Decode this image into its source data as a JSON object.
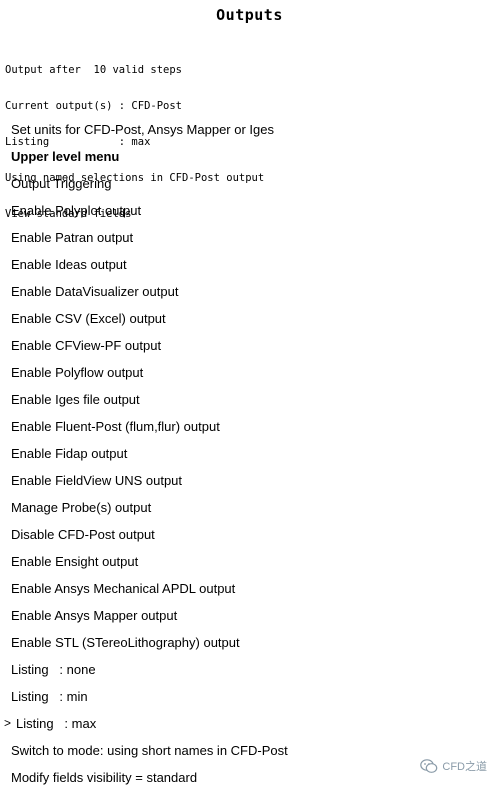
{
  "title": "Outputs",
  "status_lines": [
    "Output after  10 valid steps",
    "Current output(s) : CFD-Post",
    "Listing           : max",
    "Using named selections in CFD-Post output",
    "View standard fields"
  ],
  "menu": {
    "selected_marker": ">",
    "items": [
      {
        "label": "Set units for CFD-Post, Ansys Mapper or Iges"
      },
      {
        "label": "Upper level menu"
      },
      {
        "label": "Output Triggering"
      },
      {
        "label": "Enable Polyplot output"
      },
      {
        "label": "Enable Patran output"
      },
      {
        "label": "Enable Ideas output"
      },
      {
        "label": "Enable DataVisualizer output"
      },
      {
        "label": "Enable CSV (Excel) output"
      },
      {
        "label": "Enable CFView-PF output"
      },
      {
        "label": "Enable Polyflow output"
      },
      {
        "label": "Enable Iges file output"
      },
      {
        "label": "Enable Fluent-Post (flum,flur) output"
      },
      {
        "label": "Enable Fidap output"
      },
      {
        "label": "Enable FieldView UNS output"
      },
      {
        "label": "Manage Probe(s) output"
      },
      {
        "label": "Disable CFD-Post output"
      },
      {
        "label": "Enable Ensight output"
      },
      {
        "label": "Enable Ansys Mechanical APDL output"
      },
      {
        "label": "Enable Ansys Mapper output"
      },
      {
        "label": "Enable STL (STereoLithography) output"
      },
      {
        "label": "Listing   : none"
      },
      {
        "label": "Listing   : min"
      },
      {
        "label": "Listing   : max"
      },
      {
        "label": "Switch to mode: using short names in CFD-Post"
      },
      {
        "label": "Modify fields visibility = standard"
      }
    ]
  },
  "watermark": {
    "text": "CFD之道",
    "icon": "wechat-icon"
  }
}
